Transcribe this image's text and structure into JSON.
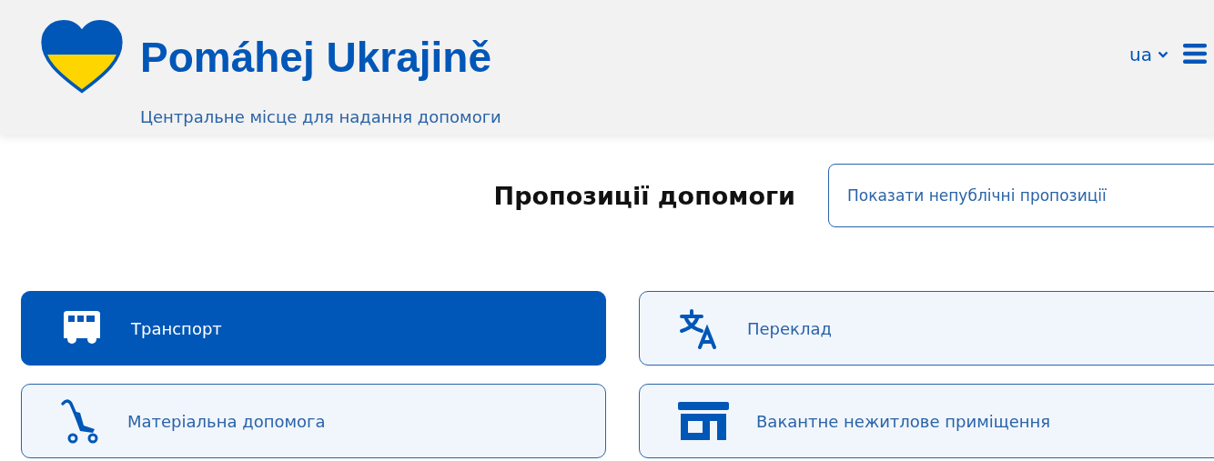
{
  "header": {
    "logo_text": "Pomáhej Ukrajině",
    "tagline": "Центральне місце для надання допомоги",
    "language": "ua"
  },
  "page": {
    "title": "Пропозиції допомоги",
    "toggle_button": "Показати непублічні пропозиції"
  },
  "categories": [
    {
      "label": "Транспорт",
      "kind": "bus",
      "selected": true
    },
    {
      "label": "Переклад",
      "kind": "translate",
      "selected": false
    },
    {
      "label": "Матеріальна допомога",
      "kind": "stroller",
      "selected": false
    },
    {
      "label": "Вакантне нежитлове приміщення",
      "kind": "shop",
      "selected": false
    }
  ]
}
